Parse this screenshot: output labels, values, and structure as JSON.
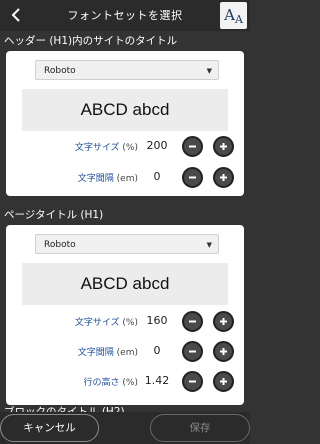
{
  "header": {
    "title": "フォントセットを選択",
    "logo_text": "A",
    "logo_text_small": "A"
  },
  "sections": [
    {
      "title": "ヘッダー (H1)内のサイトのタイトル",
      "font": "Roboto",
      "preview": "ABCD abcd",
      "rows": [
        {
          "label": "文字サイズ",
          "unit": "(%)",
          "value": "200"
        },
        {
          "label": "文字間隔",
          "unit": "(em)",
          "value": "0"
        }
      ]
    },
    {
      "title": "ページタイトル (H1)",
      "font": "Roboto",
      "preview": "ABCD abcd",
      "rows": [
        {
          "label": "文字サイズ",
          "unit": "(%)",
          "value": "160"
        },
        {
          "label": "文字間隔",
          "unit": "(em)",
          "value": "0"
        },
        {
          "label": "行の高さ",
          "unit": "(%)",
          "value": "1.42"
        }
      ]
    }
  ],
  "next_section_title_partial": "ブロックのタイトル (H2)",
  "footer": {
    "cancel_label": "キャンセル",
    "save_label": "保存"
  },
  "icons": {
    "back": "chevron-left-icon",
    "minus": "minus-icon",
    "plus": "plus-icon",
    "dropdown": "triangle-down-icon"
  }
}
